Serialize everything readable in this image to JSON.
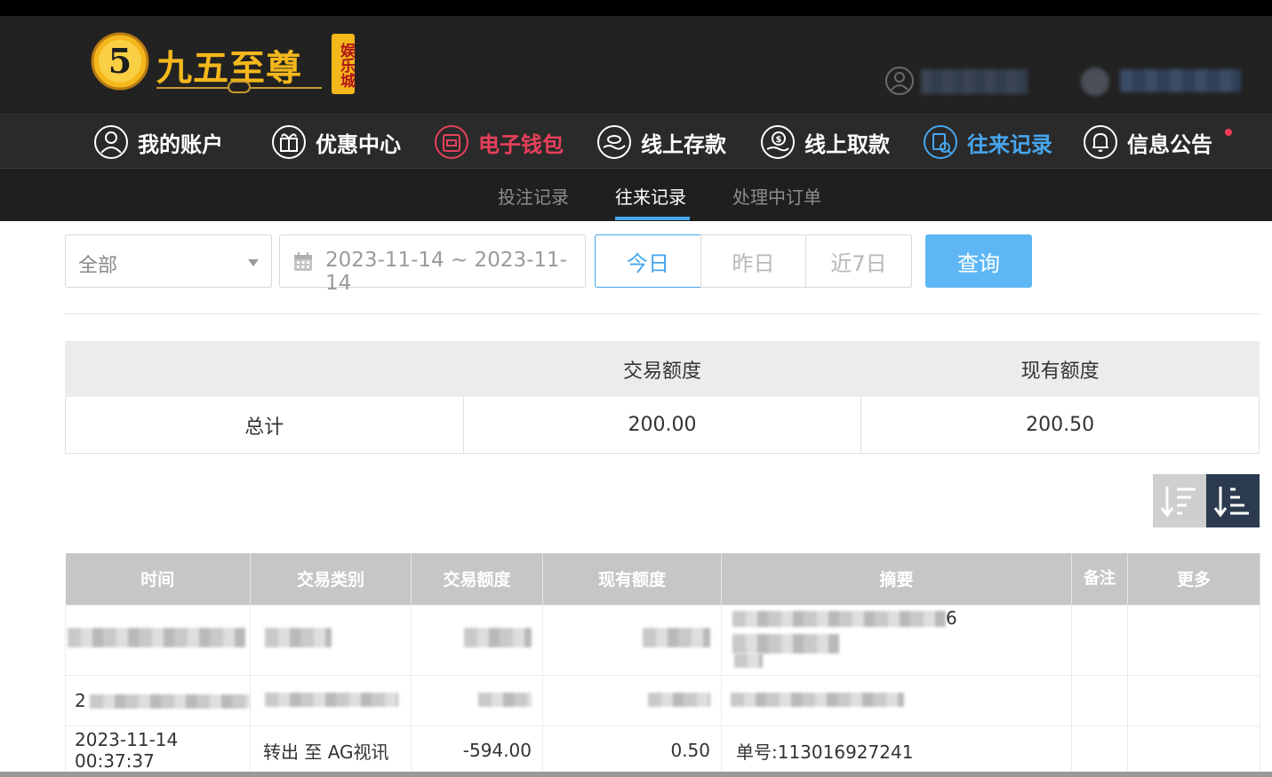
{
  "header": {
    "logo_text": "九五至尊",
    "logo_side": "娱乐城"
  },
  "nav": {
    "items": [
      {
        "label": "我的账户",
        "icon": "user-icon"
      },
      {
        "label": "优惠中心",
        "icon": "gift-icon"
      },
      {
        "label": "电子钱包",
        "icon": "wallet-icon"
      },
      {
        "label": "线上存款",
        "icon": "deposit-icon"
      },
      {
        "label": "线上取款",
        "icon": "withdraw-icon"
      },
      {
        "label": "往来记录",
        "icon": "records-icon"
      },
      {
        "label": "信息公告",
        "icon": "bell-icon"
      }
    ],
    "active_color": "#47a6ee",
    "highlight_color": "#e8405b"
  },
  "subnav": {
    "items": [
      "投注记录",
      "往来记录",
      "处理中订单"
    ],
    "active": "往来记录"
  },
  "filters": {
    "type_select": "全部",
    "date_range": "2023-11-14 ~ 2023-11-14",
    "quick": [
      "今日",
      "昨日",
      "近7日"
    ],
    "quick_active": "今日",
    "query_label": "查询"
  },
  "summary": {
    "headers": [
      "",
      "交易额度",
      "现有额度"
    ],
    "row": [
      "总计",
      "200.00",
      "200.50"
    ]
  },
  "records": {
    "headers": [
      "时间",
      "交易类别",
      "交易额度",
      "现有额度",
      "摘要",
      "备注",
      "更多"
    ],
    "rows": [
      {
        "time": "",
        "type": "",
        "amount": "",
        "balance": "",
        "summary": "6",
        "note": "",
        "more": ""
      },
      {
        "time": "2",
        "type": "",
        "amount": "",
        "balance": "",
        "summary": "",
        "note": "",
        "more": ""
      },
      {
        "time": "2023-11-14 00:37:37",
        "type": "转出 至 AG视讯",
        "amount": "-594.00",
        "balance": "0.50",
        "summary": "单号:113016927241",
        "note": "",
        "more": ""
      }
    ]
  }
}
